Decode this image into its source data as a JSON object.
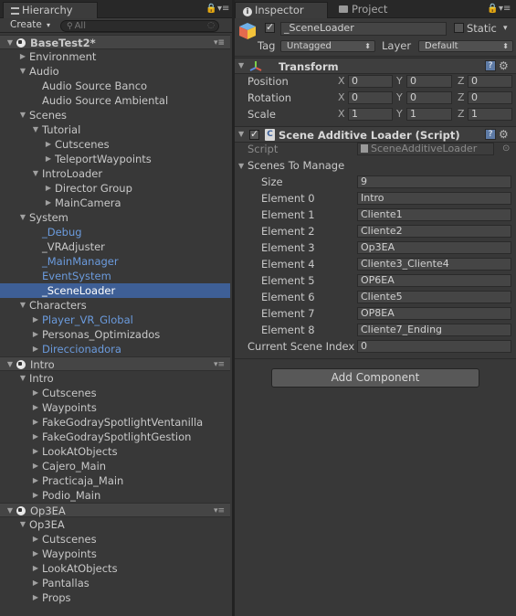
{
  "hierarchy": {
    "tab_label": "Hierarchy",
    "create_label": "Create",
    "search_placeholder": "All",
    "rows": [
      {
        "label": "BaseTest2*",
        "indent": 0,
        "arrow": "down",
        "type": "scene"
      },
      {
        "label": "Environment",
        "indent": 1,
        "arrow": "right"
      },
      {
        "label": "Audio",
        "indent": 1,
        "arrow": "down"
      },
      {
        "label": "Audio Source Banco",
        "indent": 2,
        "arrow": "none"
      },
      {
        "label": "Audio Source Ambiental",
        "indent": 2,
        "arrow": "none"
      },
      {
        "label": "Scenes",
        "indent": 1,
        "arrow": "down"
      },
      {
        "label": "Tutorial",
        "indent": 2,
        "arrow": "down"
      },
      {
        "label": "Cutscenes",
        "indent": 3,
        "arrow": "right"
      },
      {
        "label": "TeleportWaypoints",
        "indent": 3,
        "arrow": "right"
      },
      {
        "label": "IntroLoader",
        "indent": 2,
        "arrow": "down"
      },
      {
        "label": "Director Group",
        "indent": 3,
        "arrow": "right"
      },
      {
        "label": "MainCamera",
        "indent": 3,
        "arrow": "right"
      },
      {
        "label": "System",
        "indent": 1,
        "arrow": "down"
      },
      {
        "label": "_Debug",
        "indent": 2,
        "arrow": "none",
        "type": "blue"
      },
      {
        "label": "_VRAdjuster",
        "indent": 2,
        "arrow": "none"
      },
      {
        "label": "_MainManager",
        "indent": 2,
        "arrow": "none",
        "type": "blue"
      },
      {
        "label": "EventSystem",
        "indent": 2,
        "arrow": "none",
        "type": "blue"
      },
      {
        "label": "_SceneLoader",
        "indent": 2,
        "arrow": "none",
        "type": "selected"
      },
      {
        "label": "Characters",
        "indent": 1,
        "arrow": "down"
      },
      {
        "label": "Player_VR_Global",
        "indent": 2,
        "arrow": "right",
        "type": "blue"
      },
      {
        "label": "Personas_Optimizados",
        "indent": 2,
        "arrow": "right"
      },
      {
        "label": "Direccionadora",
        "indent": 2,
        "arrow": "right",
        "type": "blue"
      },
      {
        "label": "Intro",
        "indent": 0,
        "arrow": "down",
        "type": "scene-light"
      },
      {
        "label": "Intro",
        "indent": 1,
        "arrow": "down"
      },
      {
        "label": "Cutscenes",
        "indent": 2,
        "arrow": "right"
      },
      {
        "label": "Waypoints",
        "indent": 2,
        "arrow": "right"
      },
      {
        "label": "FakeGodraySpotlightVentanilla",
        "indent": 2,
        "arrow": "right"
      },
      {
        "label": "FakeGodraySpotlightGestion",
        "indent": 2,
        "arrow": "right"
      },
      {
        "label": "LookAtObjects",
        "indent": 2,
        "arrow": "right"
      },
      {
        "label": "Cajero_Main",
        "indent": 2,
        "arrow": "right"
      },
      {
        "label": "Practicaja_Main",
        "indent": 2,
        "arrow": "right"
      },
      {
        "label": "Podio_Main",
        "indent": 2,
        "arrow": "right"
      },
      {
        "label": "Op3EA",
        "indent": 0,
        "arrow": "down",
        "type": "scene-light"
      },
      {
        "label": "Op3EA",
        "indent": 1,
        "arrow": "down"
      },
      {
        "label": "Cutscenes",
        "indent": 2,
        "arrow": "right"
      },
      {
        "label": "Waypoints",
        "indent": 2,
        "arrow": "right"
      },
      {
        "label": "LookAtObjects",
        "indent": 2,
        "arrow": "right"
      },
      {
        "label": "Pantallas",
        "indent": 2,
        "arrow": "right"
      },
      {
        "label": "Props",
        "indent": 2,
        "arrow": "right"
      }
    ]
  },
  "inspector": {
    "tab_label": "Inspector",
    "project_tab_label": "Project",
    "object_name": "_SceneLoader",
    "static_label": "Static",
    "tag_label": "Tag",
    "tag_value": "Untagged",
    "layer_label": "Layer",
    "layer_value": "Default",
    "transform": {
      "title": "Transform",
      "rows": [
        {
          "label": "Position",
          "x": "0",
          "y": "0",
          "z": "0"
        },
        {
          "label": "Rotation",
          "x": "0",
          "y": "0",
          "z": "0"
        },
        {
          "label": "Scale",
          "x": "1",
          "y": "1",
          "z": "1"
        }
      ],
      "axis_labels": [
        "X",
        "Y",
        "Z"
      ]
    },
    "script_component": {
      "title": "Scene Additive Loader (Script)",
      "script_label": "Script",
      "script_value": "SceneAdditiveLoader",
      "list_label": "Scenes To Manage",
      "size_label": "Size",
      "size_value": "9",
      "elements": [
        {
          "label": "Element 0",
          "value": "Intro"
        },
        {
          "label": "Element 1",
          "value": "Cliente1"
        },
        {
          "label": "Element 2",
          "value": "Cliente2"
        },
        {
          "label": "Element 3",
          "value": "Op3EA"
        },
        {
          "label": "Element 4",
          "value": "Cliente3_Cliente4"
        },
        {
          "label": "Element 5",
          "value": "OP6EA"
        },
        {
          "label": "Element 6",
          "value": "Cliente5"
        },
        {
          "label": "Element 7",
          "value": "OP8EA"
        },
        {
          "label": "Element 8",
          "value": "Cliente7_Ending"
        }
      ],
      "current_index_label": "Current Scene Index",
      "current_index_value": "0"
    },
    "add_component_label": "Add Component"
  },
  "colors": {
    "panel_bg": "#383838",
    "selection": "#3e5f96",
    "prefab_blue": "#6b9bdd"
  }
}
